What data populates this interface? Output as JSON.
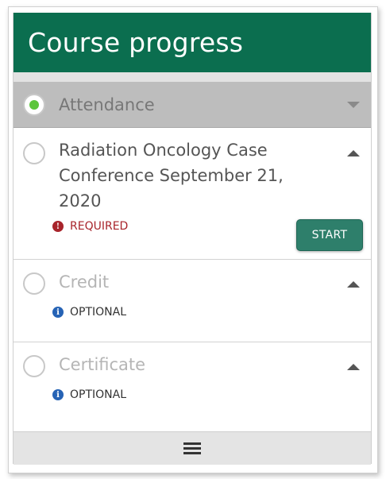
{
  "header": {
    "title": "Course progress",
    "color": "#0b6e4f"
  },
  "steps": [
    {
      "label": "Attendance",
      "active": true,
      "completed": true,
      "caret": "chevron-down-icon"
    },
    {
      "label": "Radiation Oncology Case Conference September 21, 2020",
      "status": "REQUIRED",
      "status_icon": "exclamation-circle-icon",
      "status_glyph": "!",
      "action_label": "START",
      "caret": "chevron-up-icon"
    },
    {
      "label": "Credit",
      "status": "OPTIONAL",
      "status_icon": "info-circle-icon",
      "status_glyph": "i",
      "caret": "chevron-up-icon"
    },
    {
      "label": "Certificate",
      "status": "OPTIONAL",
      "status_icon": "info-circle-icon",
      "status_glyph": "i",
      "caret": "chevron-up-icon"
    }
  ],
  "footer": {
    "icon": "hamburger-menu-icon"
  },
  "colors": {
    "completed_dot": "#5cc53b",
    "required": "#a8242b",
    "optional_icon": "#2663b5",
    "start_button": "#2e7f6b"
  }
}
